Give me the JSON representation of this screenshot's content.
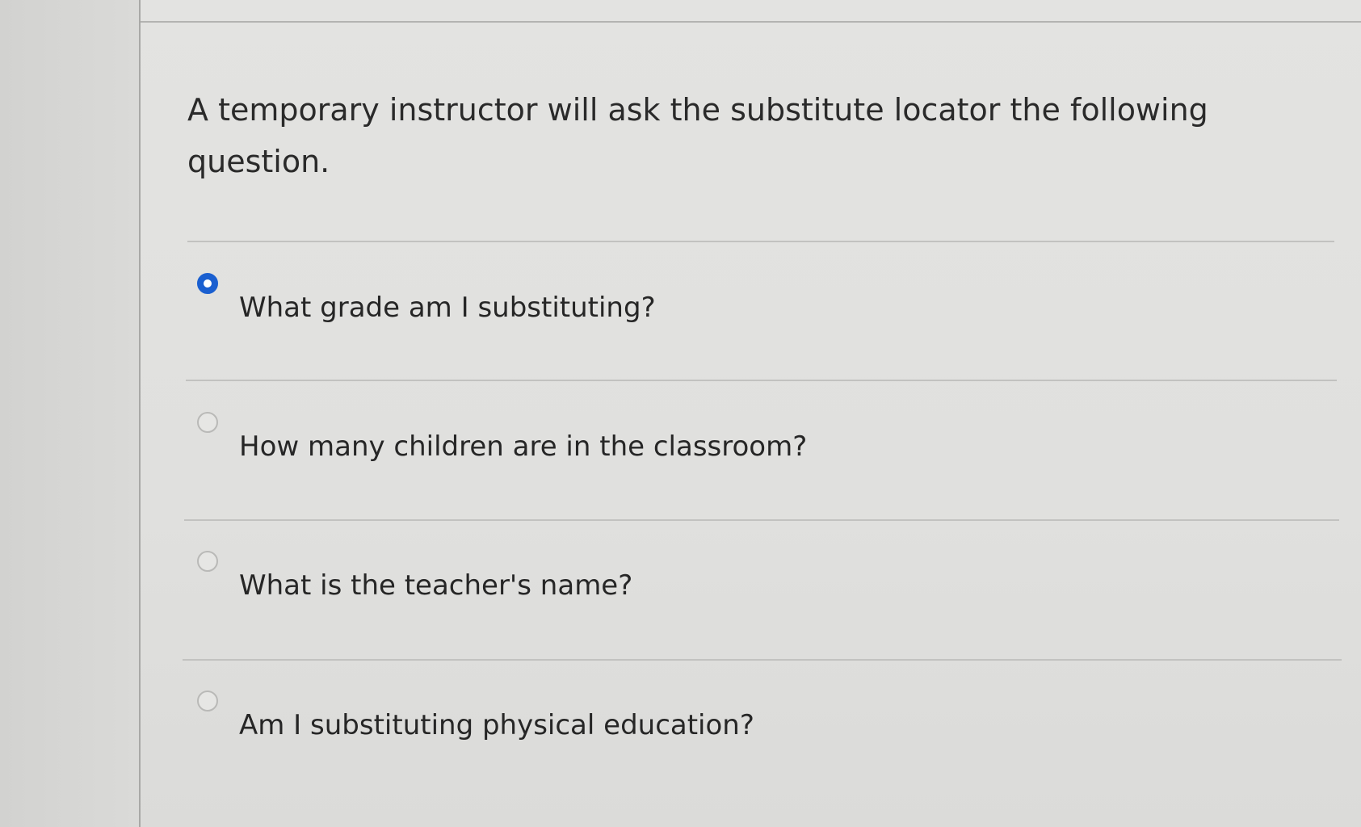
{
  "quiz": {
    "question": "A temporary instructor will ask the substitute locator the following question.",
    "answers": [
      {
        "label": "What grade am I substituting?",
        "selected": true
      },
      {
        "label": "How many children are in the classroom?",
        "selected": false
      },
      {
        "label": "What is the teacher's name?",
        "selected": false
      },
      {
        "label": "Am I substituting physical education?",
        "selected": false
      }
    ]
  },
  "colors": {
    "selected_radio": "#1a5fd0",
    "text": "#262626",
    "background": "#e1e1df"
  }
}
